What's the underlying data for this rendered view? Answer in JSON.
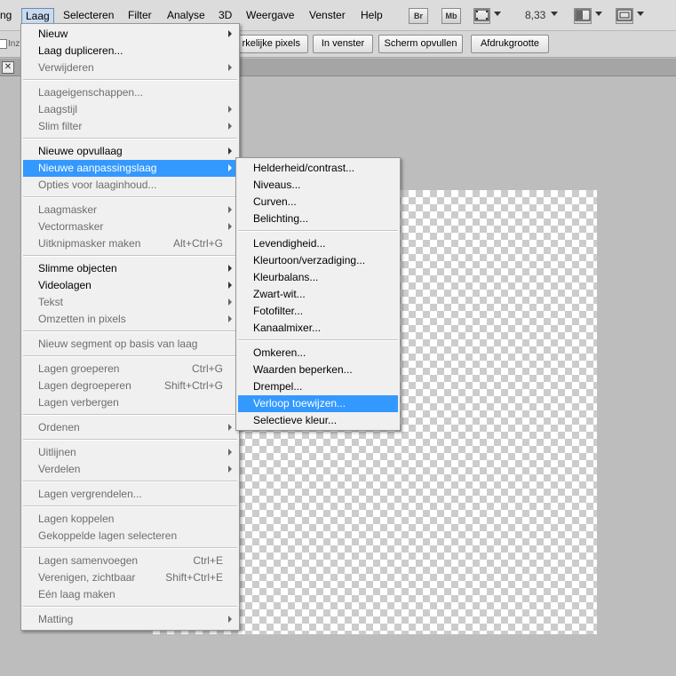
{
  "menubar": {
    "items": [
      {
        "label": "ng",
        "active": false
      },
      {
        "label": "Laag",
        "active": true
      },
      {
        "label": "Selecteren",
        "active": false
      },
      {
        "label": "Filter",
        "active": false
      },
      {
        "label": "Analyse",
        "active": false
      },
      {
        "label": "3D",
        "active": false
      },
      {
        "label": "Weergave",
        "active": false
      },
      {
        "label": "Venster",
        "active": false
      },
      {
        "label": "Help",
        "active": false
      }
    ],
    "bridge_button": "Br",
    "minibridge_button": "Mb",
    "zoom": "8,33"
  },
  "options_bar": {
    "checkbox_label": "Inz",
    "buttons": [
      "rkelijke pixels",
      "In venster",
      "Scherm opvullen",
      "Afdrukgrootte"
    ]
  },
  "tabbar": {
    "close_glyph": "✕"
  },
  "layer_menu": {
    "groups": [
      [
        {
          "label": "Nieuw",
          "disabled": false,
          "submenu": true,
          "shortcut": ""
        },
        {
          "label": "Laag dupliceren...",
          "disabled": false,
          "submenu": false,
          "shortcut": ""
        },
        {
          "label": "Verwijderen",
          "disabled": true,
          "submenu": true,
          "shortcut": ""
        }
      ],
      [
        {
          "label": "Laageigenschappen...",
          "disabled": true,
          "submenu": false,
          "shortcut": ""
        },
        {
          "label": "Laagstijl",
          "disabled": true,
          "submenu": true,
          "shortcut": ""
        },
        {
          "label": "Slim filter",
          "disabled": true,
          "submenu": true,
          "shortcut": ""
        }
      ],
      [
        {
          "label": "Nieuwe opvullaag",
          "disabled": false,
          "submenu": true,
          "shortcut": ""
        },
        {
          "label": "Nieuwe aanpassingslaag",
          "disabled": false,
          "submenu": true,
          "shortcut": "",
          "highlighted": true
        },
        {
          "label": "Opties voor laaginhoud...",
          "disabled": true,
          "submenu": false,
          "shortcut": ""
        }
      ],
      [
        {
          "label": "Laagmasker",
          "disabled": true,
          "submenu": true,
          "shortcut": ""
        },
        {
          "label": "Vectormasker",
          "disabled": true,
          "submenu": true,
          "shortcut": ""
        },
        {
          "label": "Uitknipmasker maken",
          "disabled": true,
          "submenu": false,
          "shortcut": "Alt+Ctrl+G"
        }
      ],
      [
        {
          "label": "Slimme objecten",
          "disabled": false,
          "submenu": true,
          "shortcut": ""
        },
        {
          "label": "Videolagen",
          "disabled": false,
          "submenu": true,
          "shortcut": ""
        },
        {
          "label": "Tekst",
          "disabled": true,
          "submenu": true,
          "shortcut": ""
        },
        {
          "label": "Omzetten in pixels",
          "disabled": true,
          "submenu": true,
          "shortcut": ""
        }
      ],
      [
        {
          "label": "Nieuw segment op basis van laag",
          "disabled": true,
          "submenu": false,
          "shortcut": ""
        }
      ],
      [
        {
          "label": "Lagen groeperen",
          "disabled": true,
          "submenu": false,
          "shortcut": "Ctrl+G"
        },
        {
          "label": "Lagen degroeperen",
          "disabled": true,
          "submenu": false,
          "shortcut": "Shift+Ctrl+G"
        },
        {
          "label": "Lagen verbergen",
          "disabled": true,
          "submenu": false,
          "shortcut": ""
        }
      ],
      [
        {
          "label": "Ordenen",
          "disabled": true,
          "submenu": true,
          "shortcut": ""
        }
      ],
      [
        {
          "label": "Uitlijnen",
          "disabled": true,
          "submenu": true,
          "shortcut": ""
        },
        {
          "label": "Verdelen",
          "disabled": true,
          "submenu": true,
          "shortcut": ""
        }
      ],
      [
        {
          "label": "Lagen vergrendelen...",
          "disabled": true,
          "submenu": false,
          "shortcut": ""
        }
      ],
      [
        {
          "label": "Lagen koppelen",
          "disabled": true,
          "submenu": false,
          "shortcut": ""
        },
        {
          "label": "Gekoppelde lagen selecteren",
          "disabled": true,
          "submenu": false,
          "shortcut": ""
        }
      ],
      [
        {
          "label": "Lagen samenvoegen",
          "disabled": true,
          "submenu": false,
          "shortcut": "Ctrl+E"
        },
        {
          "label": "Verenigen, zichtbaar",
          "disabled": true,
          "submenu": false,
          "shortcut": "Shift+Ctrl+E"
        },
        {
          "label": "Eén laag maken",
          "disabled": true,
          "submenu": false,
          "shortcut": ""
        }
      ],
      [
        {
          "label": "Matting",
          "disabled": true,
          "submenu": true,
          "shortcut": ""
        }
      ]
    ]
  },
  "adjustment_submenu": {
    "groups": [
      [
        {
          "label": "Helderheid/contrast..."
        },
        {
          "label": "Niveaus..."
        },
        {
          "label": "Curven..."
        },
        {
          "label": "Belichting..."
        }
      ],
      [
        {
          "label": "Levendigheid..."
        },
        {
          "label": "Kleurtoon/verzadiging..."
        },
        {
          "label": "Kleurbalans..."
        },
        {
          "label": "Zwart-wit..."
        },
        {
          "label": "Fotofilter..."
        },
        {
          "label": "Kanaalmixer..."
        }
      ],
      [
        {
          "label": "Omkeren..."
        },
        {
          "label": "Waarden beperken..."
        },
        {
          "label": "Drempel..."
        },
        {
          "label": "Verloop toewijzen...",
          "highlighted": true
        },
        {
          "label": "Selectieve kleur..."
        }
      ]
    ]
  },
  "colors": {
    "highlight": "#3399ff",
    "menu_bg": "#f0f0f0",
    "workspace": "#bdbdbd"
  }
}
